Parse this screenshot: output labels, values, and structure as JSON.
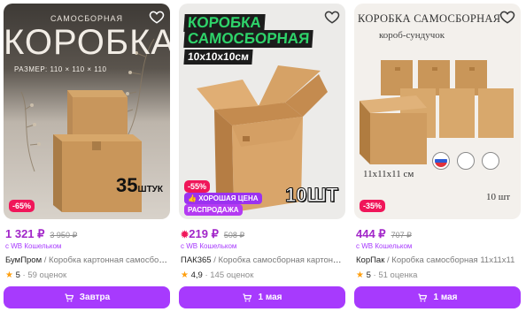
{
  "products": [
    {
      "image": {
        "line1": "САМОСБОРНАЯ",
        "line2": "КОРОБКА",
        "line3": "РАЗМЕР: 110 × 110 × 110",
        "qty": "35",
        "qty_unit": "ШТУК"
      },
      "discount": "-65%",
      "price": "1 321 ₽",
      "old_price": "3 950 ₽",
      "wallet": "с WB Кошельком",
      "brand": "БумПром",
      "name": " / Коробка картонная самосборная",
      "rating": "5",
      "reviews": "· 59 оценок",
      "delivery": "Завтра"
    },
    {
      "image": {
        "line1": "КОРОБКА",
        "line2": "САМОСБОРНАЯ",
        "line3": "10x10x10см",
        "qty": "10ШТ"
      },
      "discount": "-55%",
      "good_price": "ХОРОШАЯ ЦЕНА",
      "sale": "РАСПРОДАЖА",
      "price": "219 ₽",
      "old_price": "508 ₽",
      "wallet": "с WB Кошельком",
      "brand": "ПАК365",
      "name": " / Коробка самосборная картонная",
      "rating": "4,9",
      "reviews": "· 145 оценок",
      "delivery": "1 мая"
    },
    {
      "image": {
        "line1": "КОРОБКА САМОСБОРНАЯ",
        "line2": "короб-сундучок",
        "line3": "11x11x11 см",
        "qty": "10 шт"
      },
      "discount": "-35%",
      "price": "444 ₽",
      "old_price": "707 ₽",
      "wallet": "с WB Кошельком",
      "brand": "КорПак",
      "name": " / Коробка самосборная 11x11x11",
      "rating": "5",
      "reviews": "· 51 оценка",
      "delivery": "1 мая"
    }
  ],
  "icons": {
    "favorite": "heart-icon",
    "cart": "cart-icon",
    "star": "star-icon",
    "flame": "flame-icon"
  },
  "colors": {
    "accent": "#a73afd",
    "price": "#a226c9",
    "discount": "#f0165a",
    "star": "#ff9f0e"
  }
}
